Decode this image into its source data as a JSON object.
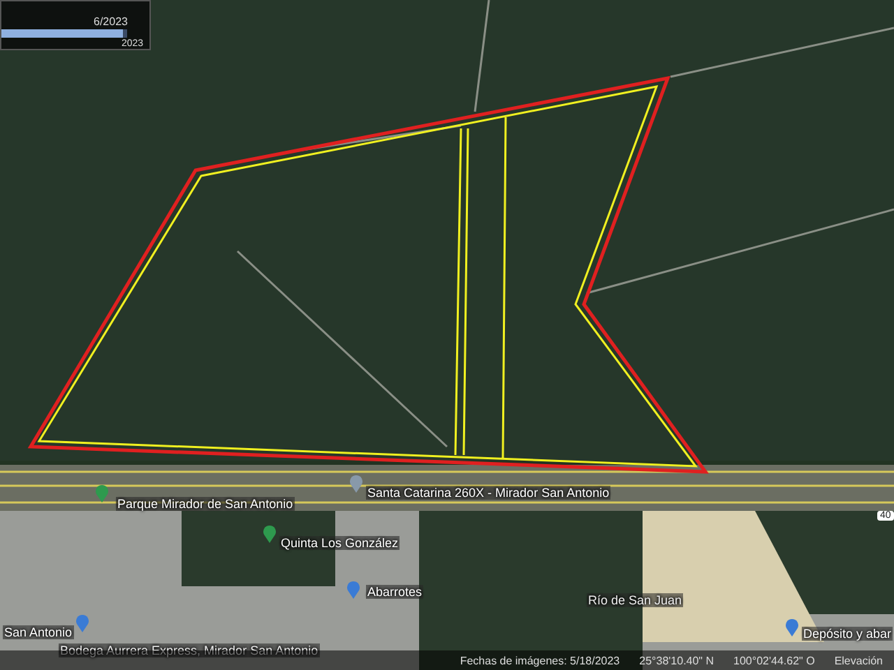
{
  "time_slider": {
    "date": "6/2023",
    "year": "2023",
    "level": 0.97
  },
  "map_labels": [
    {
      "text": "Parque Mirador de San Antonio",
      "kind": "park"
    },
    {
      "text": "Santa Catarina 260X - Mirador San Antonio",
      "kind": "place"
    },
    {
      "text": "Quinta Los González",
      "kind": "park"
    },
    {
      "text": "Abarrotes",
      "kind": "shop"
    },
    {
      "text": "San Antonio",
      "kind": "shop"
    },
    {
      "text": "Bodega Aurrera Express, Mirador San Antonio",
      "kind": "plain"
    },
    {
      "text": "Río de San Juan",
      "kind": "plain"
    },
    {
      "text": "40",
      "kind": "shield"
    },
    {
      "text": "Depósito y abar",
      "kind": "shop"
    }
  ],
  "status_bar": {
    "imagery_date": "Fechas de imágenes: 5/18/2023",
    "latitude": "25°38'10.40\" N",
    "longitude": "100°02'44.62\" O",
    "elevation": "Elevación"
  }
}
